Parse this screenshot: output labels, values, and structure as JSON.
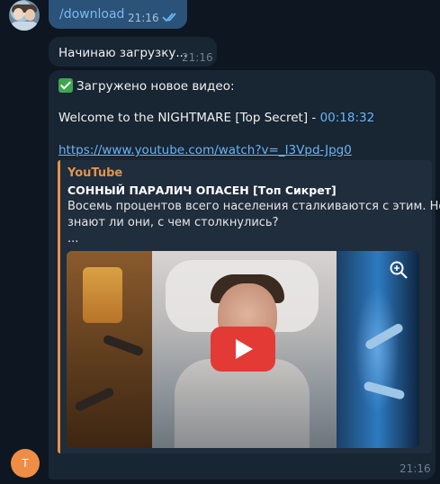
{
  "sent": {
    "command": "/download",
    "time": "21:16"
  },
  "status_message": {
    "text": "Начинаю загрузку...",
    "time": "21:16"
  },
  "video_message": {
    "header": "Загружено новое видео:",
    "title_prefix": "Welcome to the NIGHTMARE [Top Secret] - ",
    "duration": "00:18:32",
    "url": "https://www.youtube.com/watch?v=_I3Vpd-Jpg0",
    "time": "21:16",
    "preview": {
      "site": "YouTube",
      "title": "СОННЫЙ ПАРАЛИЧ ОПАСЕН [Топ Сикрет]",
      "description_line1": "Восемь процентов всего населения сталкиваются с этим. Но",
      "description_line2": "знают ли они, с чем столкнулись?",
      "ellipsis": "..."
    }
  },
  "bot_avatar_letter": "T",
  "colors": {
    "accent_link": "#6ab3f3",
    "preview_bar": "#e3944a",
    "bot_avatar": "#ee8d46"
  }
}
